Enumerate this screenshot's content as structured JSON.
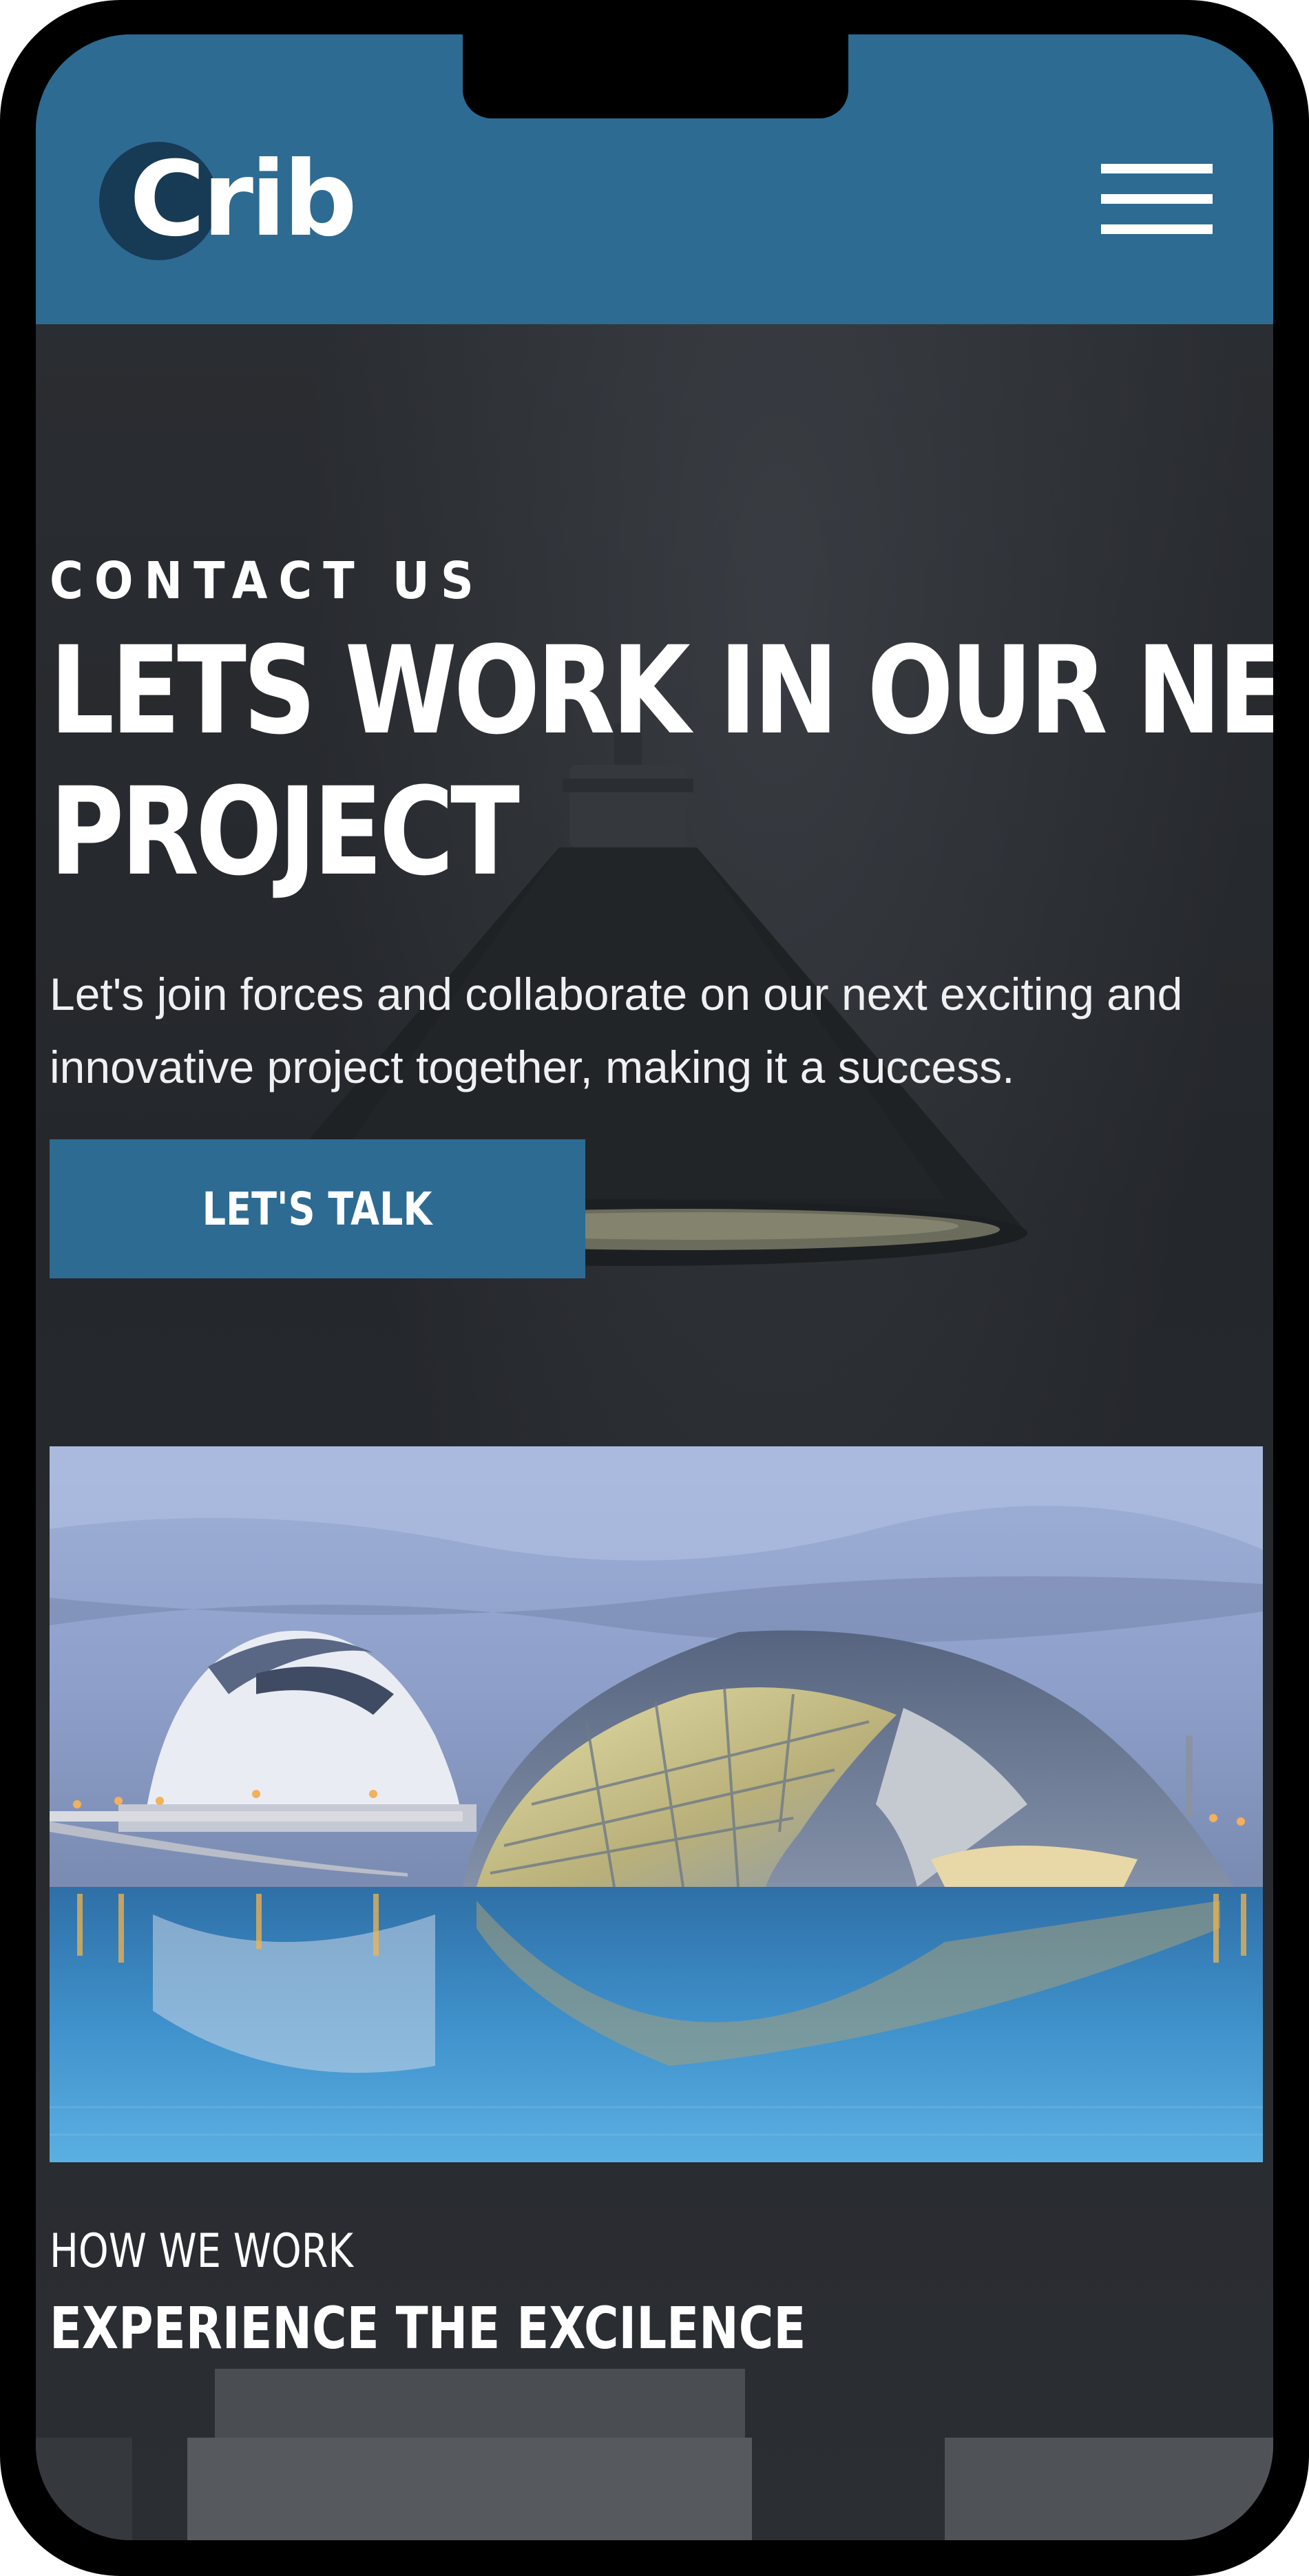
{
  "header": {
    "logo_text": "Crib",
    "menu_icon": "hamburger-menu-icon"
  },
  "hero": {
    "eyebrow": "CONTACT US",
    "title_line_1": "LETS WORK IN OUR NEXT",
    "title_line_2": "PROJECT",
    "description": "Let's join forces and collaborate on our next exciting and innovative project together, making it a success.",
    "cta_label": "LET'S TALK"
  },
  "how_we_work": {
    "kicker": "HOW WE WORK",
    "title": "EXPERIENCE THE EXCILENCE"
  },
  "colors": {
    "brand": "#2d6b92",
    "logo_dark": "#173a55",
    "background": "#25282c"
  }
}
